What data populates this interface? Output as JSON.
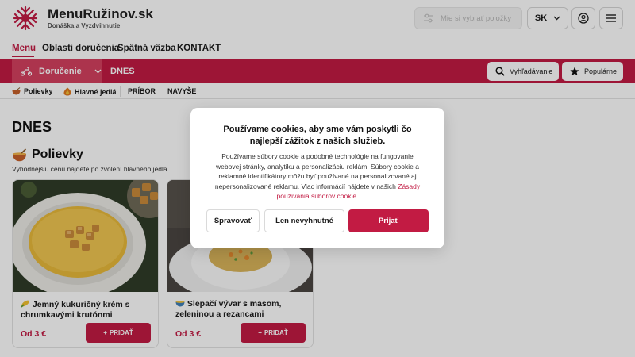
{
  "header": {
    "brand_name": "MenuRužinov.sk",
    "brand_tagline": "Donáška a Vyzdvihnutie",
    "preferences_button": "Mie si vybrať položky",
    "language": "SK"
  },
  "main_nav": {
    "items": [
      "Menu",
      "Oblasti doručenia",
      "Spätná väzba",
      "KONTAKT"
    ],
    "active": "Menu"
  },
  "service_bar": {
    "delivery_label": "Doručenie",
    "day_tab": "DNES",
    "search_label": "Vyhľadávanie",
    "popular_label": "Populárne"
  },
  "categories": [
    "Polievky",
    "Hlavné jedlá",
    "PRÍBOR",
    "NAVYŠE"
  ],
  "content": {
    "page_title": "DNES",
    "section_title": "Polievky",
    "section_note": "Výhodnejšiu cenu nájdete po zvolení hlavného jedla."
  },
  "products": [
    {
      "name": "Jemný kukuričný krém s chrumkavými krutónmi",
      "price": "Od 3 €",
      "add_label": "PRIDAŤ"
    },
    {
      "name": "Slepačí vývar s mäsom, zeleninou a rezancami",
      "price": "Od 3 €",
      "add_label": "PRIDAŤ"
    }
  ],
  "cookie_dialog": {
    "title": "Používame cookies, aby sme vám poskytli čo najlepší zážitok z našich služieb.",
    "body": "Používame súbory cookie a podobné technológie na fungovanie webovej stránky, analytiku a personalizáciu reklám. Súbory cookie a reklamné identifikátory môžu byť používané na personalizované aj nepersonalizované reklamu. Viac informácií nájdete v našich ",
    "link_text": "Zásady používania súborov cookie",
    "body_end": ".",
    "buttons": {
      "manage": "Spravovať",
      "necessary": "Len nevyhnutné",
      "accept": "Prijať"
    }
  },
  "colors": {
    "brand": "#c21b43",
    "brand_light": "#d4415f",
    "overlay": "rgba(0,0,0,0.19)"
  },
  "icons": {
    "logo": "asterisk-star-logo",
    "preferences": "filter-sliders-icon",
    "language_chevron": "chevron-down-icon",
    "account": "user-circle-icon",
    "menu": "hamburger-icon",
    "delivery": "scooter-icon",
    "delivery_chevron": "chevron-down-icon",
    "search": "search-icon",
    "popular": "star-icon",
    "soup": "soup-bowl-icon",
    "main_dish": "dish-icon",
    "corn": "corn-icon",
    "broth": "bowl-icon",
    "add": "plus-icon"
  }
}
